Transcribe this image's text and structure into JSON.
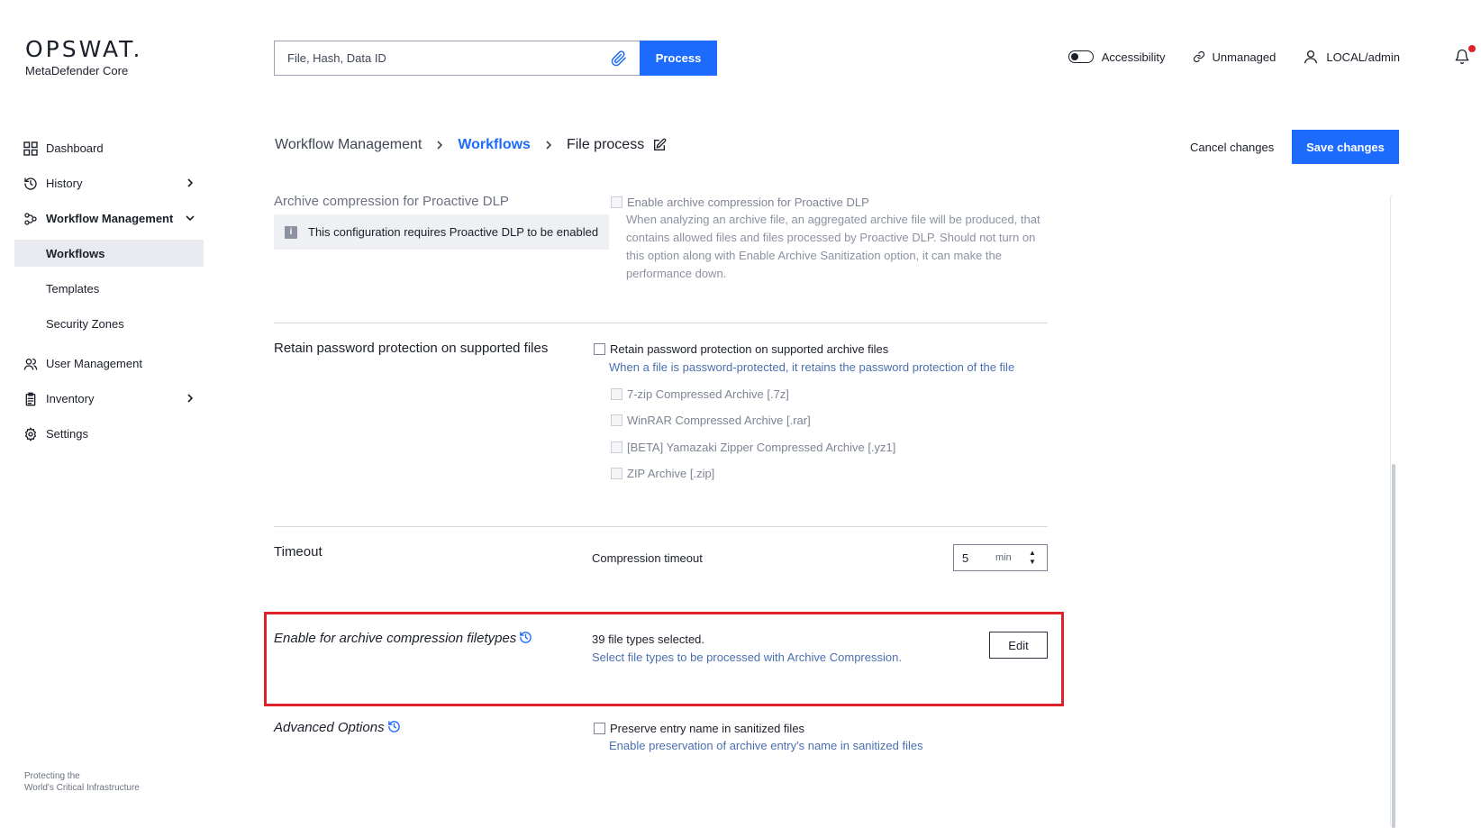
{
  "brand": {
    "name": "OPSWAT.",
    "product": "MetaDefender Core",
    "tagline_1": "Protecting the",
    "tagline_2": "World's Critical Infrastructure"
  },
  "search": {
    "placeholder": "File, Hash, Data ID",
    "process_label": "Process"
  },
  "header": {
    "accessibility_label": "Accessibility",
    "unmanaged_label": "Unmanaged",
    "user_label": "LOCAL/admin"
  },
  "sidebar": {
    "dashboard": "Dashboard",
    "history": "History",
    "workflow_management": "Workflow Management",
    "workflows": "Workflows",
    "templates": "Templates",
    "security_zones": "Security Zones",
    "user_management": "User Management",
    "inventory": "Inventory",
    "settings": "Settings"
  },
  "breadcrumb": {
    "root": "Workflow Management",
    "workflows": "Workflows",
    "current": "File process"
  },
  "actions": {
    "cancel_label": "Cancel changes",
    "save_label": "Save changes"
  },
  "archive_dlp": {
    "title": "Archive compression for Proactive DLP",
    "info_text": "This configuration requires Proactive DLP to be enabled",
    "checkbox_label": "Enable archive compression for Proactive DLP",
    "desc_1": "When analyzing an archive file, an aggregated archive file will be produced, that",
    "desc_2": "contains allowed files and files processed by Proactive DLP. Should not turn on",
    "desc_3": "this option along with Enable Archive Sanitization option, it can make the",
    "desc_4": "performance down."
  },
  "retain_password": {
    "title": "Retain password protection on supported files",
    "checkbox_label": "Retain password protection on supported archive files",
    "desc": "When a file is password-protected, it retains the password protection of the file",
    "formats": [
      "7-zip Compressed Archive [.7z]",
      "WinRAR Compressed Archive [.rar]",
      "[BETA] Yamazaki Zipper Compressed Archive [.yz1]",
      "ZIP Archive [.zip]"
    ]
  },
  "timeout": {
    "title": "Timeout",
    "label": "Compression timeout",
    "value": "5",
    "unit": "min"
  },
  "filetypes": {
    "title": "Enable for archive compression filetypes",
    "count_text": "39 file types selected.",
    "desc": "Select file types to be processed with Archive Compression.",
    "edit_label": "Edit"
  },
  "advanced": {
    "title": "Advanced Options",
    "checkbox_label": "Preserve entry name in sanitized files",
    "desc": "Enable preservation of archive entry's name in sanitized files"
  },
  "colors": {
    "accent": "#1d6bfc",
    "highlight": "#e0222a"
  }
}
